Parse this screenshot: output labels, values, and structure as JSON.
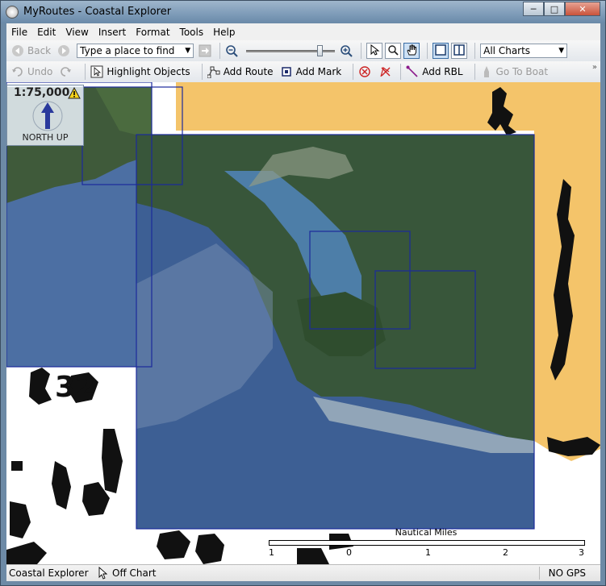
{
  "window": {
    "title": "MyRoutes - Coastal Explorer",
    "controls": {
      "minimize": "─",
      "maximize": "□",
      "close": "✕"
    }
  },
  "menu": [
    "File",
    "Edit",
    "View",
    "Insert",
    "Format",
    "Tools",
    "Help"
  ],
  "toolbar1": {
    "back_label": "Back",
    "search_placeholder": "Type a place to find",
    "zoom_level": 0.85,
    "chart_filter": "All Charts"
  },
  "toolbar2": {
    "undo_label": "Undo",
    "highlight_label": "Highlight Objects",
    "add_route_label": "Add Route",
    "add_mark_label": "Add Mark",
    "add_rbl_label": "Add RBL",
    "go_to_boat_label": "Go To Boat",
    "more_glyph": "»"
  },
  "map": {
    "scale_label": "1:75,000",
    "orientation_label": "NORTH UP",
    "scalebar": {
      "unit": "Nautical Miles",
      "ticks": [
        "1",
        "0",
        "1",
        "2",
        "3"
      ]
    },
    "chart_numbers": [
      "32"
    ],
    "colors": {
      "land": "#f4c46a",
      "water": "#3a5f8e",
      "chart_outline": "#1c2a9c"
    }
  },
  "status": {
    "app": "Coastal Explorer",
    "position": "Off Chart",
    "gps": "NO GPS"
  }
}
